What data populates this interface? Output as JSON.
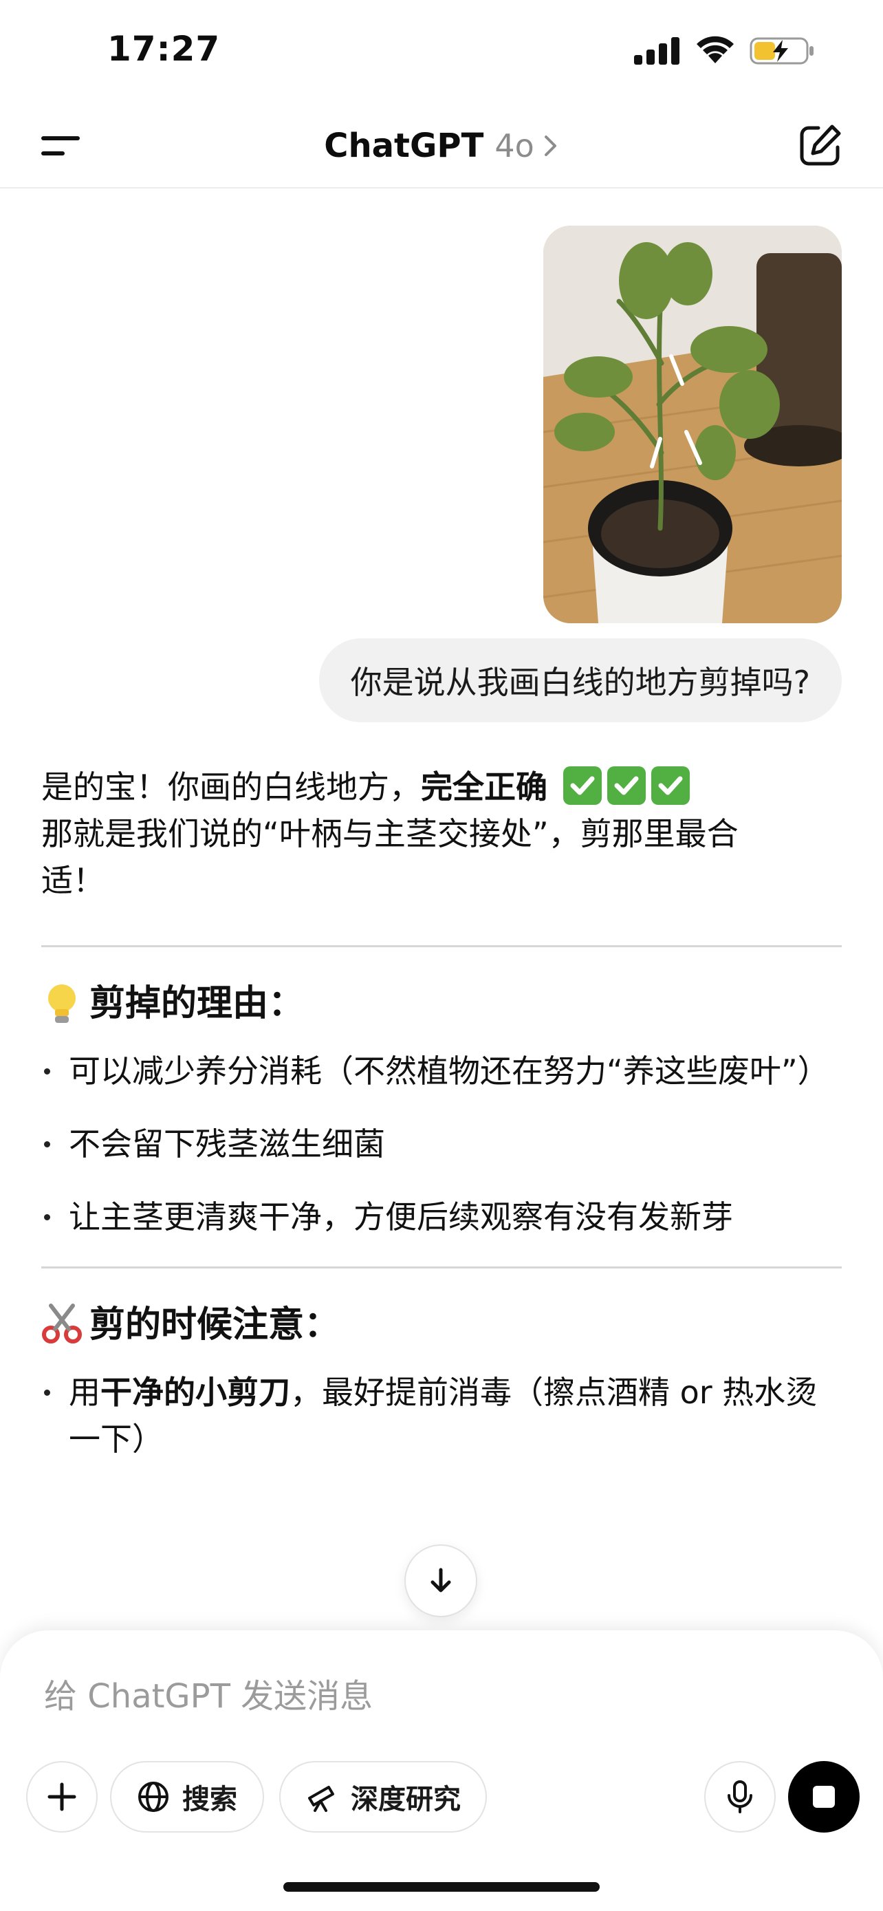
{
  "status_bar": {
    "time": "17:27"
  },
  "header": {
    "title": "ChatGPT",
    "model": "4o"
  },
  "user": {
    "message": "你是说从我画白线的地方剪掉吗?"
  },
  "assistant": {
    "intro_part1": "是的宝！你画的白线地方，",
    "intro_bold": "完全正确",
    "intro_part2": "那就是我们说的“叶柄与主茎交接处”，剪那里最合适！",
    "section1_title": "剪掉的理由：",
    "section1_items": [
      "可以减少养分消耗（不然植物还在努力“养这些废叶”）",
      "不会留下残茎滋生细菌",
      "让主茎更清爽干净，方便后续观察有没有发新芽"
    ],
    "section2_title": "剪的时候注意：",
    "section2_item1_pre": "用",
    "section2_item1_bold": "干净的小剪刀",
    "section2_item1_post": "，最好提前消毒（擦点酒精 or 热水烫一下）"
  },
  "composer": {
    "placeholder": "给 ChatGPT 发送消息",
    "search_label": "搜索",
    "deep_research_label": "深度研究"
  },
  "icons": {
    "menu": "menu-icon",
    "compose": "compose-icon",
    "plus": "plus-icon",
    "globe": "globe-icon",
    "telescope": "telescope-icon",
    "mic": "microphone-icon",
    "stop": "stop-icon",
    "scroll": "arrow-down-icon"
  },
  "colors": {
    "accent_check": "#52b043",
    "user_bubble": "#f1f1f1"
  }
}
